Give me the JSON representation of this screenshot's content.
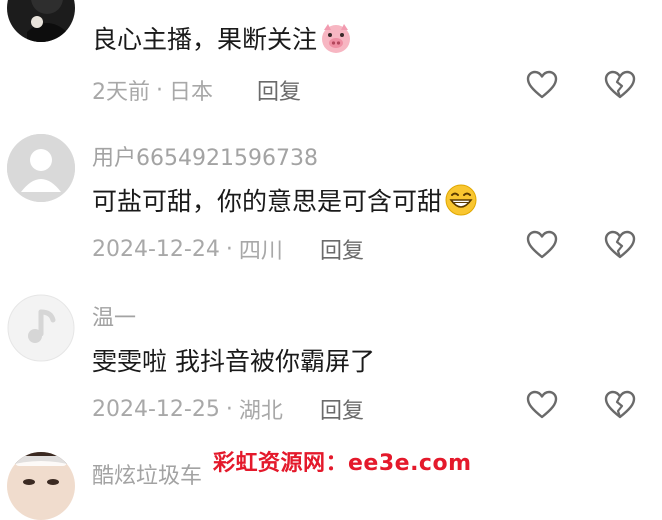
{
  "comments": [
    {
      "text": "良心主播，果断关注",
      "emoji": "pig-face-emoji",
      "date": "2天前",
      "sep": "·",
      "location": "日本",
      "reply": "回复"
    },
    {
      "username": "用户6654921596738",
      "text": "可盐可甜，你的意思是可含可甜",
      "emoji": "grinning-face-emoji",
      "date": "2024-12-24",
      "sep": "·",
      "location": "四川",
      "reply": "回复"
    },
    {
      "username": "温一",
      "text": "雯雯啦 我抖音被你霸屏了",
      "date": "2024-12-25",
      "sep": "·",
      "location": "湖北",
      "reply": "回复"
    },
    {
      "username": "酷炫垃圾车"
    }
  ],
  "watermark": "彩虹资源网：ee3e.com",
  "icons": {
    "like": "heart-outline-icon",
    "dislike": "broken-heart-icon"
  }
}
